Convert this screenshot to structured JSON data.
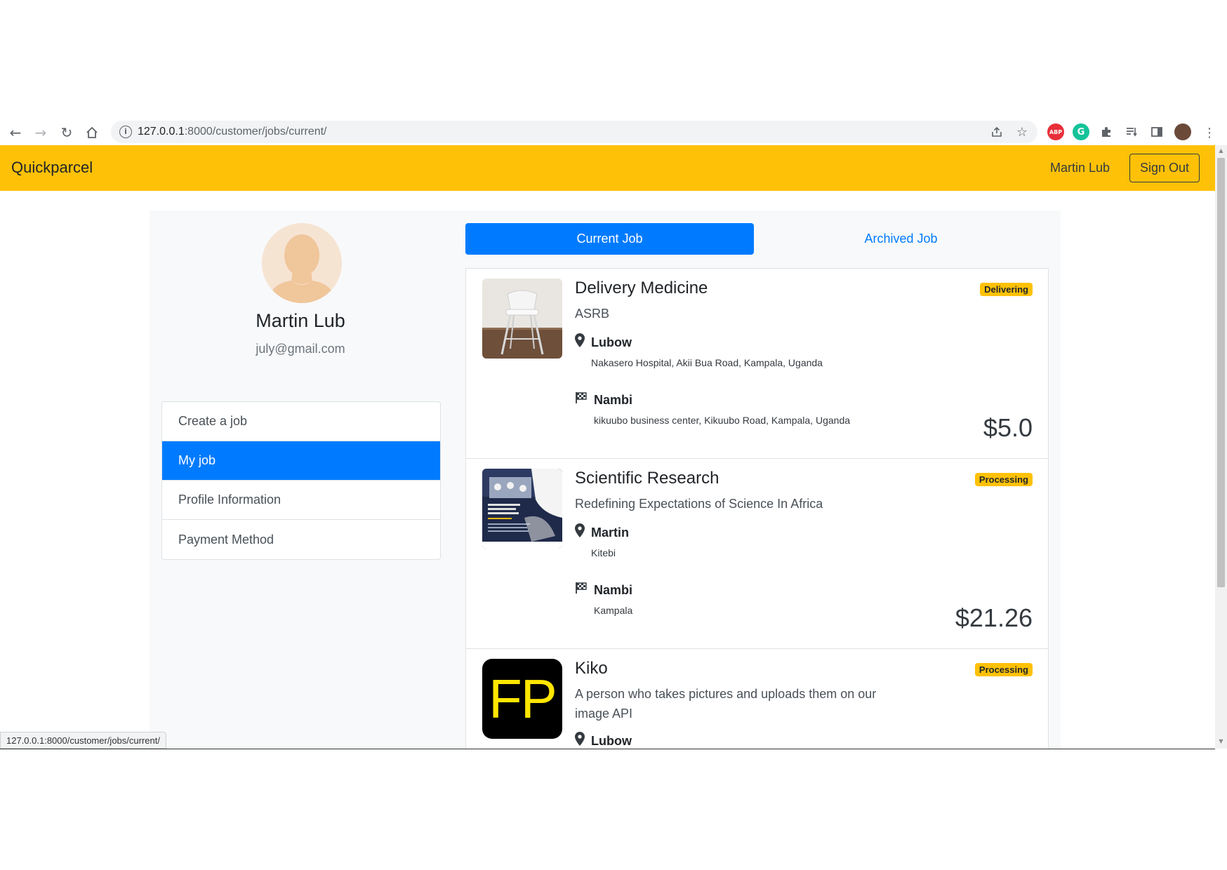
{
  "browser": {
    "url_host": "127.0.0.1",
    "url_rest": ":8000/customer/jobs/current/",
    "status_url": "127.0.0.1:8000/customer/jobs/current/",
    "ext_abp": "ABP",
    "ext_grammarly": "G"
  },
  "navbar": {
    "brand": "Quickparcel",
    "user": "Martin Lub",
    "signout": "Sign Out",
    "bg_color": "#ffc107"
  },
  "profile": {
    "name": "Martin Lub",
    "email": "july@gmail.com"
  },
  "menu": {
    "items": [
      "Create a job",
      "My job",
      "Profile Information",
      "Payment Method"
    ],
    "active": "My job"
  },
  "tabs": {
    "current": "Current Job",
    "archived": "Archived Job"
  },
  "jobs": [
    {
      "title": "Delivery Medicine",
      "description": "ASRB",
      "status": "Delivering",
      "pickup_name": "Lubow",
      "pickup_address": "Nakasero Hospital, Akii Bua Road, Kampala, Uganda",
      "dropoff_name": "Nambi",
      "dropoff_address": "kikuubo business center, Kikuubo Road, Kampala, Uganda",
      "price": "$5.0"
    },
    {
      "title": "Scientific Research",
      "description": "Redefining Expectations of Science In Africa",
      "status": "Processing",
      "pickup_name": "Martin",
      "pickup_address": "Kitebi",
      "dropoff_name": "Nambi",
      "dropoff_address": "Kampala",
      "price": "$21.26"
    },
    {
      "title": "Kiko",
      "description": "A person who takes pictures and uploads them on our image API",
      "status": "Processing",
      "pickup_name": "Lubow",
      "thumb_text": "FP"
    }
  ],
  "colors": {
    "primary": "#007bff",
    "warning": "#ffc107"
  }
}
